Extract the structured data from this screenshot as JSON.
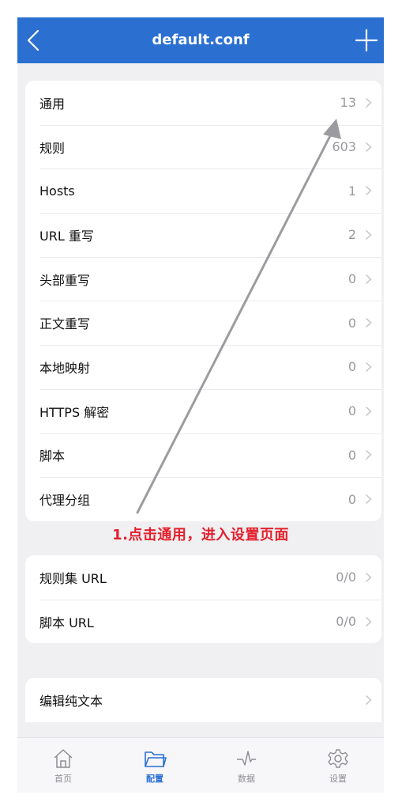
{
  "navbar": {
    "title": "default.conf",
    "back_icon": "chevron-left-icon",
    "add_icon": "plus-icon",
    "bg_color": "#2b6fd1"
  },
  "group1": [
    {
      "label": "通用",
      "value": "13"
    },
    {
      "label": "规则",
      "value": "603"
    },
    {
      "label": "Hosts",
      "value": "1"
    },
    {
      "label": "URL 重写",
      "value": "2"
    },
    {
      "label": "头部重写",
      "value": "0"
    },
    {
      "label": "正文重写",
      "value": "0"
    },
    {
      "label": "本地映射",
      "value": "0"
    },
    {
      "label": "HTTPS 解密",
      "value": "0"
    },
    {
      "label": "脚本",
      "value": "0"
    },
    {
      "label": "代理分组",
      "value": "0"
    }
  ],
  "annotation": {
    "text": "1.点击通用，进入设置页面",
    "color": "#e3202d"
  },
  "group2": [
    {
      "label": "规则集 URL",
      "value": "0/0"
    },
    {
      "label": "脚本 URL",
      "value": "0/0"
    }
  ],
  "group3": [
    {
      "label": "编辑纯文本",
      "value": ""
    }
  ],
  "tabbar": {
    "items": [
      {
        "label": "首页",
        "icon": "home-icon"
      },
      {
        "label": "配置",
        "icon": "folder-icon"
      },
      {
        "label": "数据",
        "icon": "activity-icon"
      },
      {
        "label": "设置",
        "icon": "gear-icon"
      }
    ],
    "active_index": 1
  }
}
